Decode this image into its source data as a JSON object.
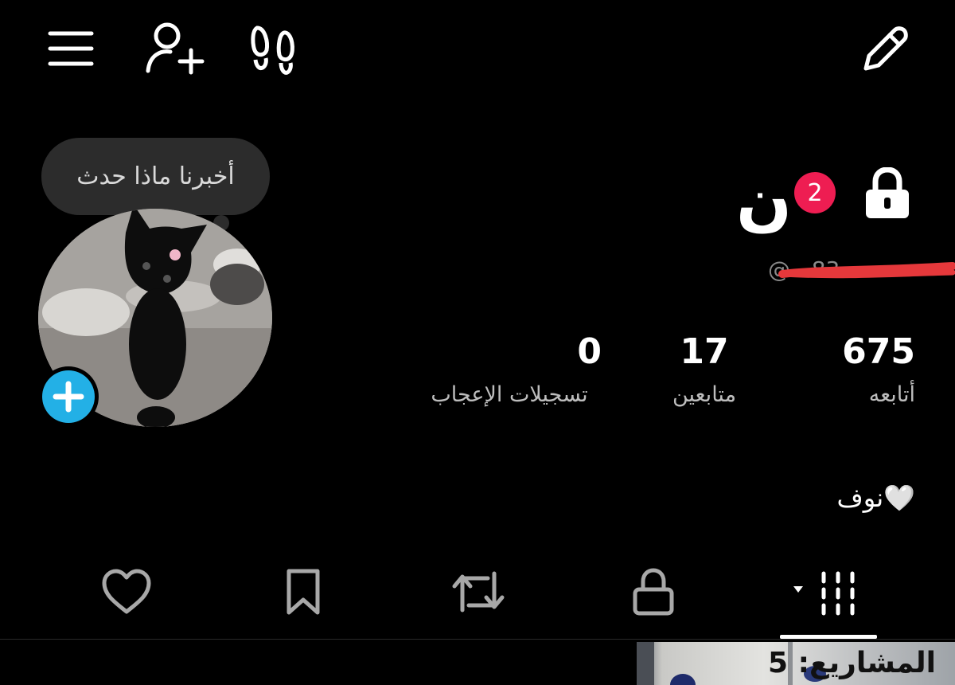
{
  "top_bar": {
    "menu_icon": "hamburger-menu-icon",
    "add_friend_icon": "add-user-icon",
    "footprints_icon": "footprints-icon",
    "edit_icon": "pencil-icon"
  },
  "story_bubble": {
    "text": "أخبرنا ماذا حدث"
  },
  "profile": {
    "display_name": "ن",
    "badge_count": "2",
    "username": "@...83",
    "bio": "نوف🤍"
  },
  "stats": {
    "following": {
      "value": "675",
      "label": "أتابعه"
    },
    "followers": {
      "value": "17",
      "label": "متابعين"
    },
    "likes": {
      "value": "0",
      "label": "تسجيلات الإعجاب"
    }
  },
  "tabs": [
    {
      "icon": "grid-icon",
      "active": true
    },
    {
      "icon": "lock-icon",
      "active": false
    },
    {
      "icon": "repost-icon",
      "active": false
    },
    {
      "icon": "bookmark-icon",
      "active": false
    },
    {
      "icon": "heart-icon",
      "active": false
    }
  ],
  "thumbnail": {
    "caption": "المشاريع: 5"
  },
  "colors": {
    "background": "#000000",
    "badge": "#ee1d52",
    "add_story": "#23b0e6",
    "muted_text": "#bdbdbd"
  }
}
